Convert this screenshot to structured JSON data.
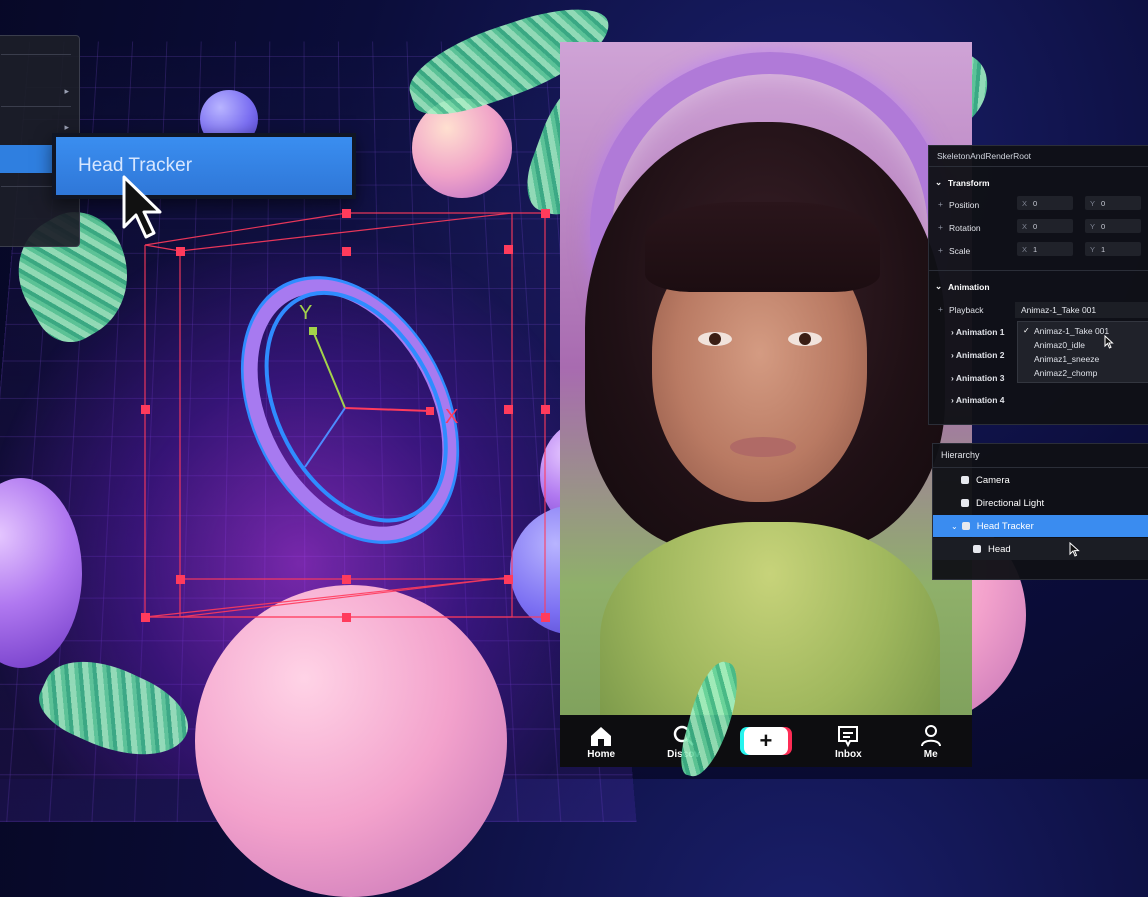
{
  "left_panel": {
    "head_tracker_label": "Head Tracker"
  },
  "gizmo": {
    "y_axis_label": "Y",
    "x_axis_label": "X"
  },
  "inspector": {
    "title": "SkeletonAndRenderRoot",
    "transform": {
      "section_label": "Transform",
      "position": {
        "label": "Position",
        "x_axis": "X",
        "x": "0",
        "y_axis": "Y",
        "y": "0"
      },
      "rotation": {
        "label": "Rotation",
        "x_axis": "X",
        "x": "0",
        "y_axis": "Y",
        "y": "0"
      },
      "scale": {
        "label": "Scale",
        "x_axis": "X",
        "x": "1",
        "y_axis": "Y",
        "y": "1"
      }
    },
    "animation": {
      "section_label": "Animation",
      "playback_label": "Playback",
      "playback_value": "Animaz-1_Take 001",
      "items": [
        "Animation 1",
        "Animation 2",
        "Animation 3",
        "Animation 4"
      ],
      "options": [
        "Animaz-1_Take 001",
        "Animaz0_idle",
        "Animaz1_sneeze",
        "Animaz2_chomp"
      ],
      "selected_option_index": 0
    }
  },
  "hierarchy": {
    "title": "Hierarchy",
    "items": [
      {
        "label": "Camera"
      },
      {
        "label": "Directional Light"
      },
      {
        "label": "Head Tracker",
        "selected": true
      },
      {
        "label": "Head"
      }
    ]
  },
  "phone": {
    "tabs": [
      {
        "label": "Home",
        "icon": "home-icon"
      },
      {
        "label": "Discov",
        "icon": "search-icon"
      },
      {
        "label": "",
        "icon": "plus-icon"
      },
      {
        "label": "Inbox",
        "icon": "inbox-icon"
      },
      {
        "label": "Me",
        "icon": "profile-icon"
      }
    ]
  },
  "colors": {
    "selection_blue": "#3a8cf0",
    "gizmo_red": "#ff3b5c",
    "background": "#0b0d3a"
  }
}
